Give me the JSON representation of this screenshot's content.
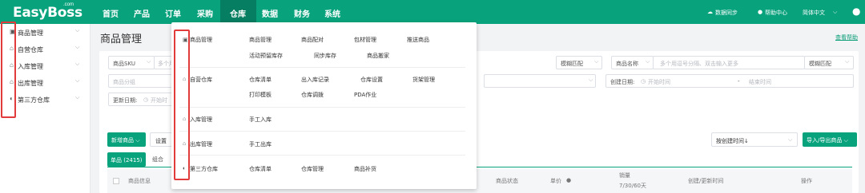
{
  "header": {
    "logo": "EasyBoss",
    "logo_sup": ".com",
    "nav": [
      "首页",
      "产品",
      "订单",
      "采购",
      "仓库",
      "数据",
      "财务",
      "系统"
    ],
    "active_nav": "仓库",
    "sync": "数据同步",
    "help": "帮助中心",
    "lang": "简体中文"
  },
  "sidebar": {
    "items": [
      {
        "label": "商品管理",
        "icon": "goods-icon"
      },
      {
        "label": "自营仓库",
        "icon": "warehouse-icon"
      },
      {
        "label": "入库管理",
        "icon": "inbound-icon"
      },
      {
        "label": "出库管理",
        "icon": "outbound-icon"
      },
      {
        "label": "第三方仓库",
        "icon": "third-party-icon"
      }
    ]
  },
  "page": {
    "title": "商品管理",
    "help_link": "查看帮助"
  },
  "filters": {
    "sku_select": "商品SKU",
    "sku_placeholder": "多个用",
    "match1": "模糊匹配",
    "name_select": "商品名称",
    "name_placeholder": "多个用逗号分隔、双击输入更多",
    "match2": "模糊匹配",
    "category_placeholder": "商品分组",
    "create_date_label": "创建日期:",
    "start_placeholder": "开始时间",
    "dash": "-",
    "end_placeholder": "结束时间",
    "update_date_label": "更新日期:",
    "update_start_placeholder": "开始时"
  },
  "toolbar": {
    "new_goods": "新增商品",
    "settings": "设置",
    "sort": "按创建时间↓",
    "import_export": "导入/导出商品",
    "tab_single": "单品 (2415)",
    "tab_combo": "组合"
  },
  "table": {
    "columns": [
      "商品信息",
      "商品状态",
      "单价",
      "销量",
      "7/30/60天",
      "创建/更新时间",
      "操作"
    ]
  },
  "dropdown": {
    "groups": [
      {
        "title": "商品管理",
        "icon": "goods-icon",
        "items": [
          "商品管理",
          "商品配对",
          "包材管理",
          "推送商品",
          "活动预留库存",
          "同步库存",
          "商品搬家"
        ]
      },
      {
        "title": "自营仓库",
        "icon": "warehouse-icon",
        "items": [
          "仓库清单",
          "出入库记录",
          "仓库设置",
          "货架管理",
          "打印模板",
          "仓库调拨",
          "PDA作业"
        ]
      },
      {
        "title": "入库管理",
        "icon": "inbound-icon",
        "items": [
          "手工入库"
        ]
      },
      {
        "title": "出库管理",
        "icon": "outbound-icon",
        "items": [
          "手工出库"
        ]
      },
      {
        "title": "第三方仓库",
        "icon": "third-party-icon",
        "items": [
          "仓库清单",
          "仓库管理",
          "商品补货"
        ]
      }
    ]
  },
  "colors": {
    "primary": "#08a27c",
    "highlight": "#e23b3b"
  }
}
